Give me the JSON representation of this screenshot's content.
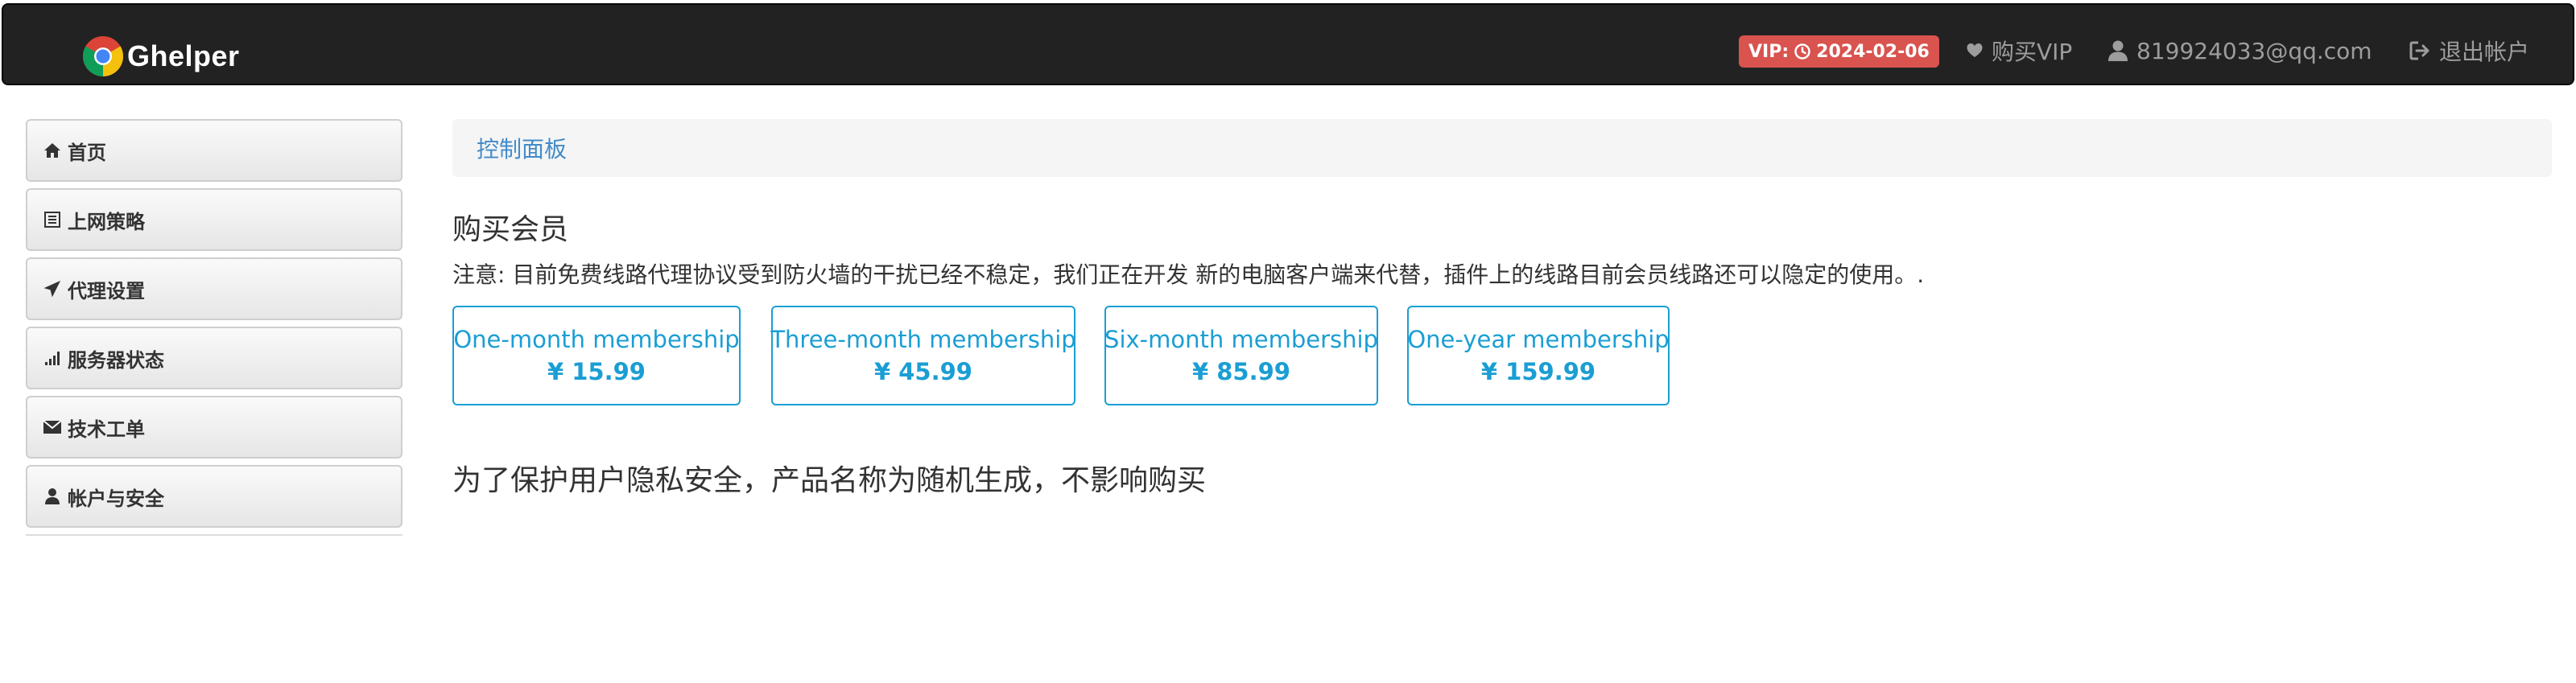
{
  "brand": {
    "name": "Ghelper"
  },
  "header": {
    "vip_label": "VIP:",
    "vip_expiry": "2024-02-06",
    "buy_vip": "购买VIP",
    "user_email": "819924033@qq.com",
    "logout": "退出帐户"
  },
  "sidebar": {
    "items": [
      {
        "label": "首页",
        "icon": "home-icon"
      },
      {
        "label": "上网策略",
        "icon": "list-icon"
      },
      {
        "label": "代理设置",
        "icon": "send-icon"
      },
      {
        "label": "服务器状态",
        "icon": "signal-icon"
      },
      {
        "label": "技术工单",
        "icon": "envelope-icon"
      },
      {
        "label": "帐户与安全",
        "icon": "user-icon"
      }
    ]
  },
  "breadcrumb": {
    "current": "控制面板"
  },
  "main": {
    "title": "购买会员",
    "notice": "注意: 目前免费线路代理协议受到防火墙的干扰已经不稳定，我们正在开发 新的电脑客户端来代替，插件上的线路目前会员线路还可以隐定的使用。.",
    "plans": [
      {
        "name": "One-month membership",
        "price": "¥ 15.99"
      },
      {
        "name": "Three-month membership",
        "price": "¥ 45.99"
      },
      {
        "name": "Six-month membership",
        "price": "¥ 85.99"
      },
      {
        "name": "One-year membership",
        "price": "¥ 159.99"
      }
    ],
    "privacy_note": "为了保护用户隐私安全，产品名称为随机生成，不影响购买"
  },
  "colors": {
    "navbar_bg": "#222222",
    "badge_danger": "#d9534f",
    "link_blue": "#428bca",
    "plan_accent": "#1a9ed4"
  }
}
